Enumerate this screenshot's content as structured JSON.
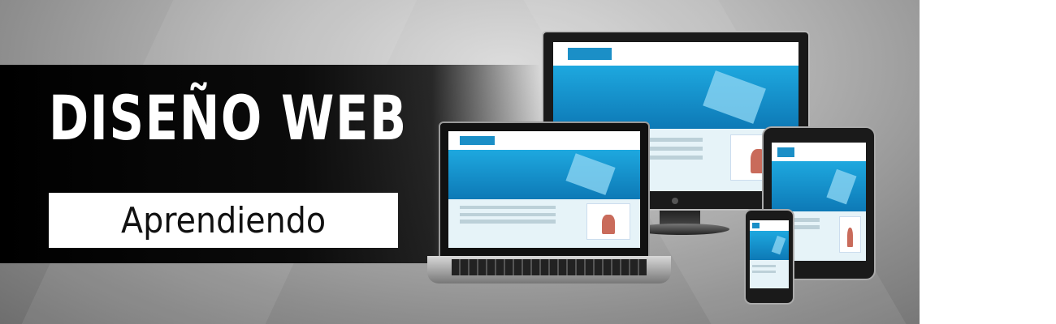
{
  "banner": {
    "title": "DISEÑO WEB",
    "subtitle": "Aprendiendo"
  },
  "colors": {
    "band": "#000000",
    "accent": "#1ea8df",
    "subtitle_bg": "#ffffff"
  },
  "devices": {
    "items": [
      "monitor",
      "laptop",
      "tablet",
      "phone"
    ]
  }
}
